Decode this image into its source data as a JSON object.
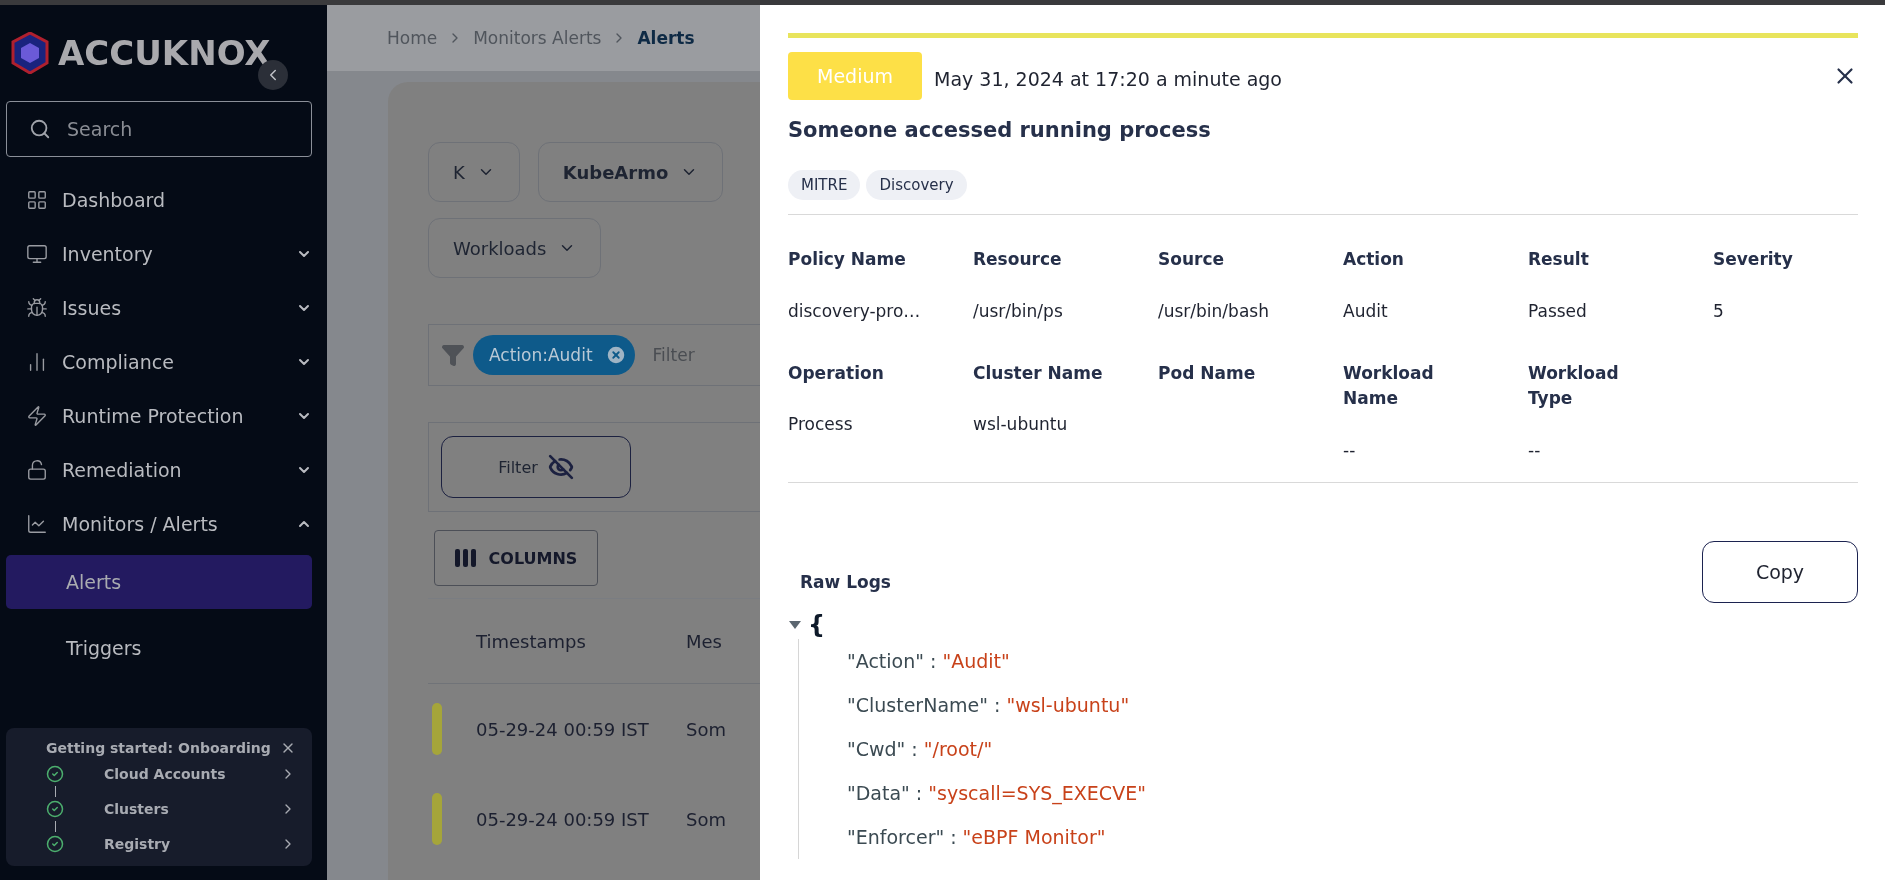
{
  "sidebar": {
    "logo": "ACCUKNOX",
    "search": {
      "placeholder": "Search"
    },
    "nav": [
      {
        "label": "Dashboard",
        "kind": "link"
      },
      {
        "label": "Inventory",
        "kind": "group",
        "expanded": false
      },
      {
        "label": "Issues",
        "kind": "group",
        "expanded": false
      },
      {
        "label": "Compliance",
        "kind": "group",
        "expanded": false
      },
      {
        "label": "Runtime Protection",
        "kind": "group",
        "expanded": false
      },
      {
        "label": "Remediation",
        "kind": "group",
        "expanded": false
      },
      {
        "label": "Monitors / Alerts",
        "kind": "group",
        "expanded": true,
        "children": [
          {
            "label": "Alerts",
            "selected": true
          },
          {
            "label": "Triggers",
            "selected": false
          }
        ]
      }
    ],
    "onboarding": {
      "title": "Getting started: Onboarding",
      "steps": [
        {
          "label": "Cloud Accounts",
          "done": true
        },
        {
          "label": "Clusters",
          "done": true
        },
        {
          "label": "Registry",
          "done": true
        }
      ]
    }
  },
  "main": {
    "breadcrumb": [
      {
        "label": "Home",
        "current": false
      },
      {
        "label": "Monitors Alerts",
        "current": false
      },
      {
        "label": "Alerts",
        "current": true
      }
    ],
    "dropdowns": [
      "K",
      "KubeArmo",
      "Workloads"
    ],
    "filter_chips": [
      "Action:Audit"
    ],
    "filter_placeholder": "Filter",
    "filter_button": "Filter",
    "columns_button": "COLUMNS",
    "table": {
      "columns": [
        "Timestamps",
        "Mes"
      ],
      "rows": [
        {
          "timestamp": "05-29-24 00:59 IST",
          "message": "Som"
        },
        {
          "timestamp": "05-29-24 00:59 IST",
          "message": "Som"
        }
      ]
    }
  },
  "panel": {
    "severity": "Medium",
    "time": "May 31, 2024 at 17:20 a minute ago",
    "title": "Someone accessed running process",
    "tags": [
      "MITRE",
      "Discovery"
    ],
    "fields": [
      {
        "label": "Policy Name",
        "value": "discovery-pro…"
      },
      {
        "label": "Resource",
        "value": "/usr/bin/ps"
      },
      {
        "label": "Source",
        "value": "/usr/bin/bash"
      },
      {
        "label": "Action",
        "value": "Audit"
      },
      {
        "label": "Result",
        "value": "Passed"
      },
      {
        "label": "Severity",
        "value": "5"
      },
      {
        "label": "Operation",
        "value": "Process"
      },
      {
        "label": "Cluster Name",
        "value": "wsl-ubuntu"
      },
      {
        "label": "Pod Name"
      },
      {
        "label": "Workload Name",
        "value": "--"
      },
      {
        "label": "Workload Type",
        "value": "--"
      }
    ],
    "raw_logs": {
      "title": "Raw Logs",
      "copy": "Copy",
      "expanded": true,
      "open_brace": "{",
      "entries": [
        {
          "key": "\"Action\"",
          "separator": ":",
          "value": "\"Audit\""
        },
        {
          "key": "\"ClusterName\"",
          "separator": ":",
          "value": "\"wsl-ubuntu\""
        },
        {
          "key": "\"Cwd\"",
          "separator": ":",
          "value": "\"/root/\""
        },
        {
          "key": "\"Data\"",
          "separator": ":",
          "value": "\"syscall=SYS_EXECVE\""
        },
        {
          "key": "\"Enforcer\"",
          "separator": ":",
          "value": "\"eBPF Monitor\""
        }
      ]
    }
  }
}
